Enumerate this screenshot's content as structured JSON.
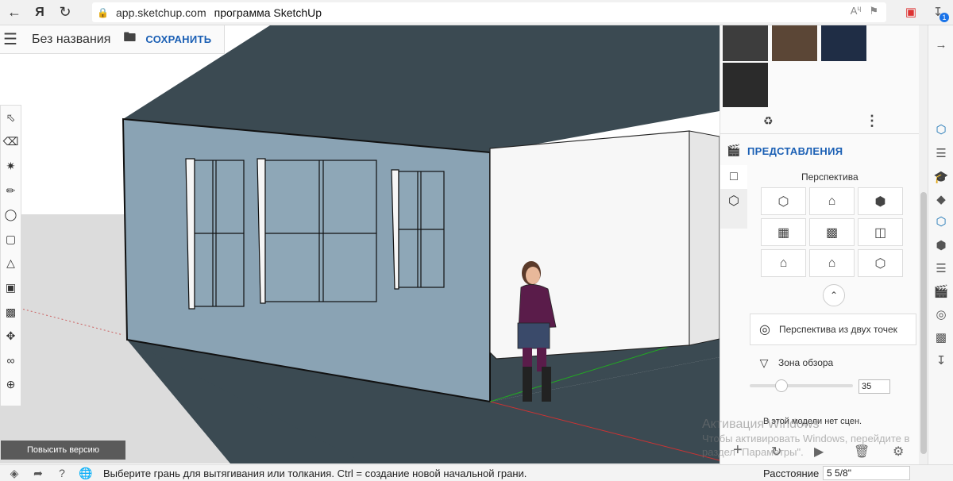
{
  "browser": {
    "url": "app.sketchup.com",
    "page_title": "программа SketchUp",
    "back_icon": "arrow-left-icon",
    "yandex_icon": "yandex-icon",
    "reload_icon": "reload-icon",
    "download_badge": "1"
  },
  "app": {
    "doc_name": "Без названия",
    "save_label": "СОХРАНИТЬ",
    "upgrade_label": "Повысить версию"
  },
  "toolbar": {
    "tools": [
      "select-tool-icon",
      "eraser-tool-icon",
      "paint-bucket-icon",
      "pencil-line-icon",
      "arc-tool-icon",
      "rectangle-tool-icon",
      "push-pull-icon",
      "offset-tool-icon",
      "tape-measure-icon",
      "move-tool-icon",
      "walk-tool-icon",
      "orbit-tool-icon"
    ]
  },
  "panel": {
    "swatch_colors": [
      "#3d3d3d",
      "#5b4636",
      "#1f2d45",
      "#2b2b2b"
    ],
    "scenes_title": "ПРЕДСТАВЛЕНИЯ",
    "perspective_label": "Перспектива",
    "two_point_label": "Перспектива из двух точек",
    "fov_label": "Зона обзора",
    "fov_value": "35",
    "no_scenes": "В этой модели нет сцен."
  },
  "status": {
    "message": "Выберите грань для вытягивания или толкания. Ctrl = создание новой начальной грани.",
    "distance_label": "Расстояние",
    "distance_value": "5 5/8\""
  },
  "watermark": {
    "title": "Активация Windows",
    "line1": "Чтобы активировать Windows, перейдите в",
    "line2": "раздел \"Параметры\"."
  }
}
